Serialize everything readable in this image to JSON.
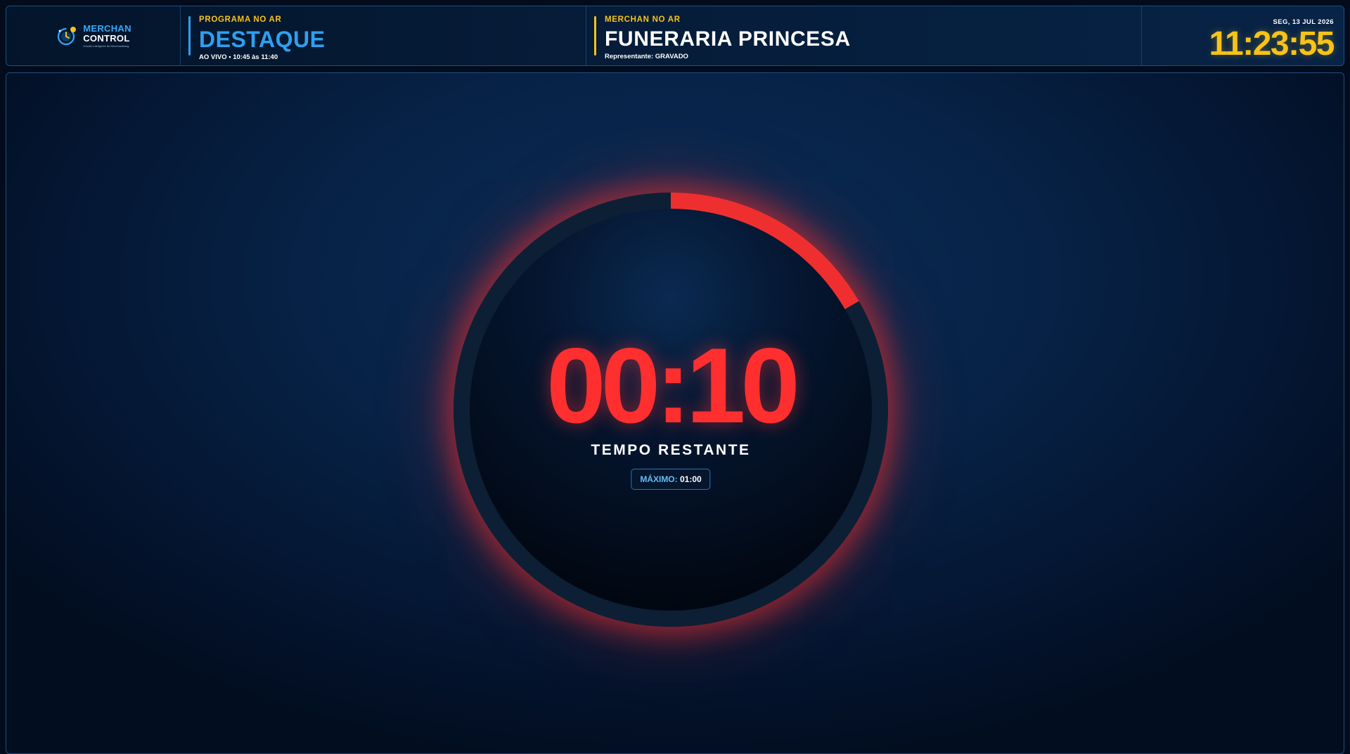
{
  "brand": {
    "line1": "MERCHAN",
    "line2": "CONTROL",
    "tagline": "Gestão Inteligente de Merchandising",
    "icon": "globe-clock-icon"
  },
  "program": {
    "kicker": "PROGRAMA NO AR",
    "name": "DESTAQUE",
    "details": "AO VIVO • 10:45 às 11:40",
    "accent_color": "#2f9ff0"
  },
  "merchan": {
    "kicker": "MERCHAN NO AR",
    "name": "FUNERARIA PRINCESA",
    "representative": "Representante: GRAVADO",
    "accent_color": "#f7c318"
  },
  "clock": {
    "date": "SEG, 13 JUL 2026",
    "time": "11:23:55"
  },
  "timer": {
    "remaining": "00:10",
    "label": "TEMPO RESTANTE",
    "max_label": "MÁXIMO:",
    "max_value": "01:00",
    "progress_fraction": 0.1667,
    "progress_color": "#ef2f2f",
    "track_color": "#0d1f34"
  }
}
